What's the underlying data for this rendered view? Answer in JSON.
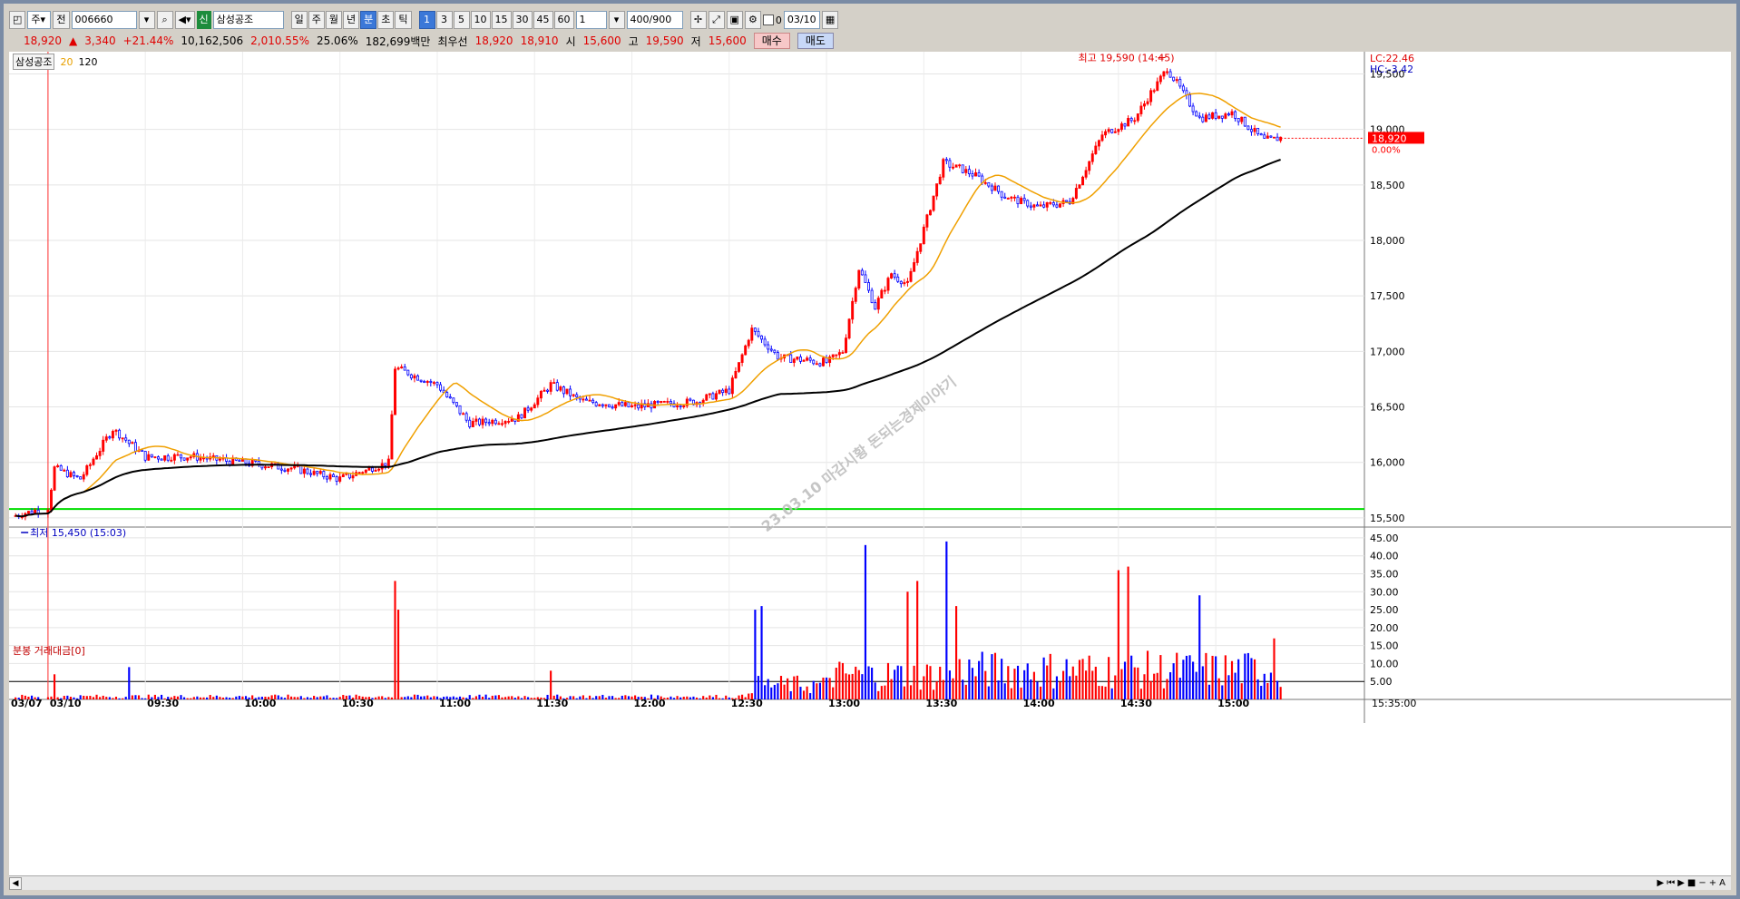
{
  "toolbar": {
    "period_type": "주",
    "scope": "전",
    "code": "006660",
    "shin": "신",
    "name": "삼성공조",
    "tabs": [
      {
        "label": "일",
        "active": false
      },
      {
        "label": "주",
        "active": false
      },
      {
        "label": "월",
        "active": false
      },
      {
        "label": "년",
        "active": false
      },
      {
        "label": "분",
        "active": true
      },
      {
        "label": "초",
        "active": false
      },
      {
        "label": "틱",
        "active": false
      }
    ],
    "intervals": [
      {
        "label": "1",
        "active": true
      },
      {
        "label": "3",
        "active": false
      },
      {
        "label": "5",
        "active": false
      },
      {
        "label": "10",
        "active": false
      },
      {
        "label": "15",
        "active": false
      },
      {
        "label": "30",
        "active": false
      },
      {
        "label": "45",
        "active": false
      },
      {
        "label": "60",
        "active": false
      }
    ],
    "interval_value": "1",
    "count": "400",
    "count_total": "/900",
    "checkbox_label": "0",
    "date": "03/10"
  },
  "info": {
    "price": "18,920",
    "arrow": "▲",
    "change": "3,340",
    "change_pct": "+21.44%",
    "volume": "10,162,506",
    "vol_pct": "2,010.55%",
    "turnover": "25.06%",
    "amount": "182,699백만",
    "best_label": "최우선",
    "best_ask": "18,920",
    "best_bid": "18,910",
    "open_label": "시",
    "open": "15,600",
    "high_label": "고",
    "high": "19,590",
    "low_label": "저",
    "low": "15,600",
    "buy_label": "매수",
    "sell_label": "매도"
  },
  "legend": {
    "name": "삼성공조",
    "ma20": "20",
    "ma120": "120",
    "volume_title": "분봉 거래대금[0]"
  },
  "annotations": {
    "high": "최고 19,590 (14:45)",
    "low": "최저 15,450 (15:03)",
    "lc": "LC:22.46",
    "hc": "HC:-3.42",
    "current_price": "18,920",
    "current_pct": "0.00%",
    "watermark": "23.03.10 마감시황 돈되는경제이야기",
    "end_time": "15:35:00"
  },
  "colors": {
    "up": "#ff0000",
    "down": "#0000ff",
    "ma20": "#f0a000",
    "ma120": "#000000",
    "ref_line": "#00dd00"
  },
  "chart_data": {
    "type": "candlestick",
    "title": "삼성공조",
    "interval": "1분",
    "price_axis": {
      "min": 15450,
      "max": 19700,
      "ticks": [
        15500,
        16000,
        16500,
        17000,
        17500,
        18000,
        18500,
        19000,
        19500
      ]
    },
    "volume_axis": {
      "min": 0,
      "max": 47,
      "unit": "억",
      "ticks": [
        5,
        10,
        15,
        20,
        25,
        30,
        35,
        40,
        45
      ],
      "tick_labels": [
        "5.00",
        "10.00",
        "15.00",
        "20.00",
        "25.00",
        "30.00",
        "35.00",
        "40.00",
        "45.00"
      ]
    },
    "x_labels": [
      "03/07",
      "03/10",
      "09:30",
      "10:00",
      "10:30",
      "11:00",
      "11:30",
      "12:00",
      "12:30",
      "13:00",
      "13:30",
      "14:00",
      "14:30",
      "15:00"
    ],
    "reference_price": 15580,
    "high": {
      "value": 19590,
      "time": "14:45"
    },
    "low": {
      "value": 15450,
      "time": "15:03"
    },
    "last_price": 18920,
    "price_path_keypoints": [
      [
        "03/07",
        15520
      ],
      [
        "09:00",
        15600
      ],
      [
        "09:02",
        15950
      ],
      [
        "09:10",
        15850
      ],
      [
        "09:20",
        16300
      ],
      [
        "09:30",
        16050
      ],
      [
        "09:45",
        16050
      ],
      [
        "10:00",
        16000
      ],
      [
        "10:15",
        15950
      ],
      [
        "10:30",
        15850
      ],
      [
        "10:45",
        16000
      ],
      [
        "10:47",
        16850
      ],
      [
        "11:00",
        16700
      ],
      [
        "11:10",
        16350
      ],
      [
        "11:25",
        16400
      ],
      [
        "11:35",
        16700
      ],
      [
        "11:45",
        16550
      ],
      [
        "12:00",
        16500
      ],
      [
        "12:20",
        16550
      ],
      [
        "12:30",
        16650
      ],
      [
        "12:37",
        17200
      ],
      [
        "12:45",
        16950
      ],
      [
        "13:00",
        16900
      ],
      [
        "13:05",
        17000
      ],
      [
        "13:10",
        17750
      ],
      [
        "13:15",
        17400
      ],
      [
        "13:20",
        17700
      ],
      [
        "13:25",
        17600
      ],
      [
        "13:30",
        18100
      ],
      [
        "13:36",
        18700
      ],
      [
        "13:45",
        18600
      ],
      [
        "13:55",
        18400
      ],
      [
        "14:05",
        18300
      ],
      [
        "14:15",
        18350
      ],
      [
        "14:25",
        18950
      ],
      [
        "14:35",
        19100
      ],
      [
        "14:45",
        19550
      ],
      [
        "14:55",
        19100
      ],
      [
        "15:05",
        19150
      ],
      [
        "15:15",
        18900
      ],
      [
        "15:20",
        18920
      ]
    ],
    "volume_spikes": [
      [
        "09:02",
        7
      ],
      [
        "09:25",
        9
      ],
      [
        "10:47",
        33
      ],
      [
        "10:48",
        25
      ],
      [
        "11:35",
        8
      ],
      [
        "12:38",
        25
      ],
      [
        "12:40",
        26
      ],
      [
        "13:12",
        43
      ],
      [
        "13:25",
        30
      ],
      [
        "13:28",
        33
      ],
      [
        "13:37",
        44
      ],
      [
        "13:40",
        26
      ],
      [
        "14:30",
        36
      ],
      [
        "14:33",
        37
      ],
      [
        "14:55",
        29
      ],
      [
        "15:18",
        17
      ]
    ]
  }
}
